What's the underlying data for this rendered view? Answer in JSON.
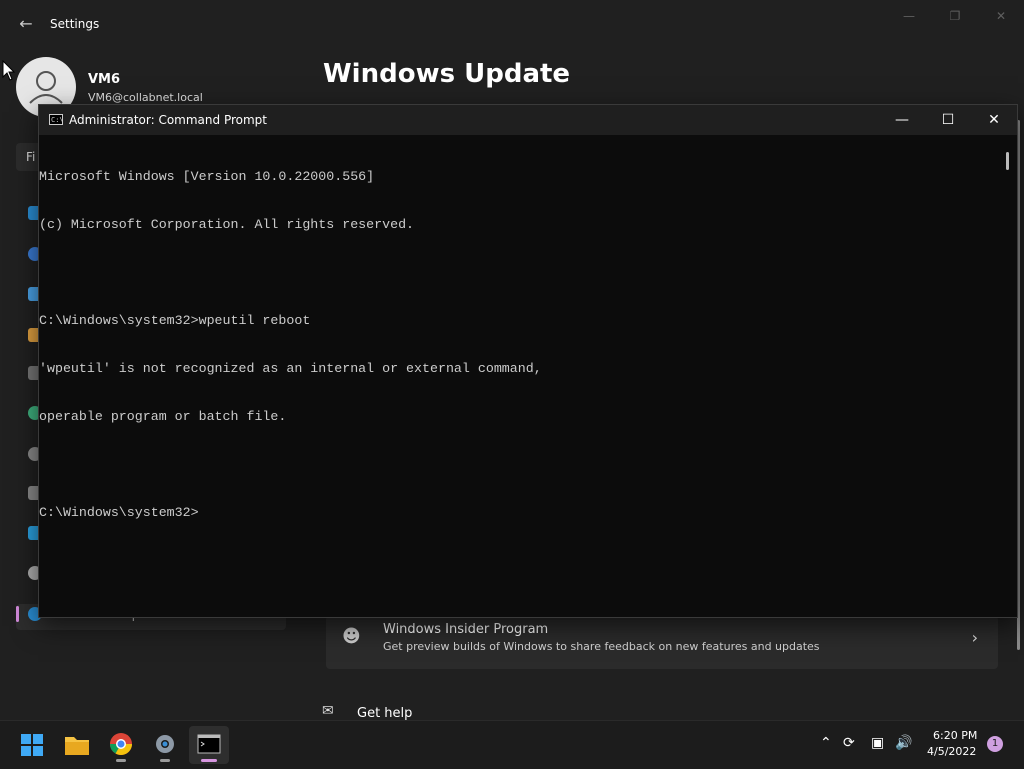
{
  "settings": {
    "title": "Settings",
    "user": {
      "name": "VM6",
      "email": "VM6@collabnet.local"
    },
    "page_title": "Windows Update",
    "find_placeholder": "Fi",
    "active_nav_label": "Windows Update",
    "insider": {
      "title": "Windows Insider Program",
      "subtitle": "Get preview builds of Windows to share feedback on new features and updates"
    },
    "get_help": "Get help"
  },
  "cmd": {
    "title": "Administrator: Command Prompt",
    "lines": [
      "Microsoft Windows [Version 10.0.22000.556]",
      "(c) Microsoft Corporation. All rights reserved.",
      "",
      "C:\\Windows\\system32>wpeutil reboot",
      "'wpeutil' is not recognized as an internal or external command,",
      "operable program or batch file.",
      "",
      "C:\\Windows\\system32>"
    ]
  },
  "taskbar": {
    "time": "6:20 PM",
    "date": "4/5/2022",
    "notification_count": "1",
    "apps": [
      "start",
      "file-explorer",
      "chrome",
      "settings",
      "command-prompt"
    ]
  },
  "colors": {
    "accent": "#d796e0",
    "console_bg": "#0c0c0c",
    "console_text": "#cccccc"
  }
}
